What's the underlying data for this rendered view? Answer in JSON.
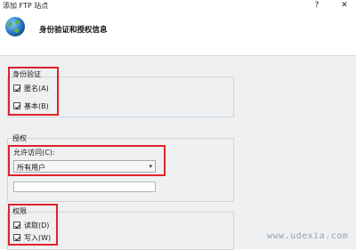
{
  "window": {
    "title": "添加 FTP 站点",
    "help_label": "?",
    "close_label": "✕"
  },
  "header": {
    "icon": "globe-icon",
    "heading": "身份验证和授权信息"
  },
  "authentication": {
    "title": "身份验证",
    "anonymous": {
      "label": "匿名(A)",
      "checked": true
    },
    "basic": {
      "label": "基本(B)",
      "checked": true
    }
  },
  "authorization": {
    "title": "授权",
    "allow_access_label": "允许访问(C):",
    "allow_access_value": "所有用户",
    "dropdown_arrow": "▾",
    "user_input_value": ""
  },
  "permissions": {
    "title": "权限",
    "read": {
      "label": "读取(D)",
      "checked": true
    },
    "write": {
      "label": "写入(W)",
      "checked": true
    }
  },
  "watermark": "www.udexia.com",
  "colors": {
    "highlight_border": "#e0232a",
    "content_bg": "#eef0f2"
  }
}
